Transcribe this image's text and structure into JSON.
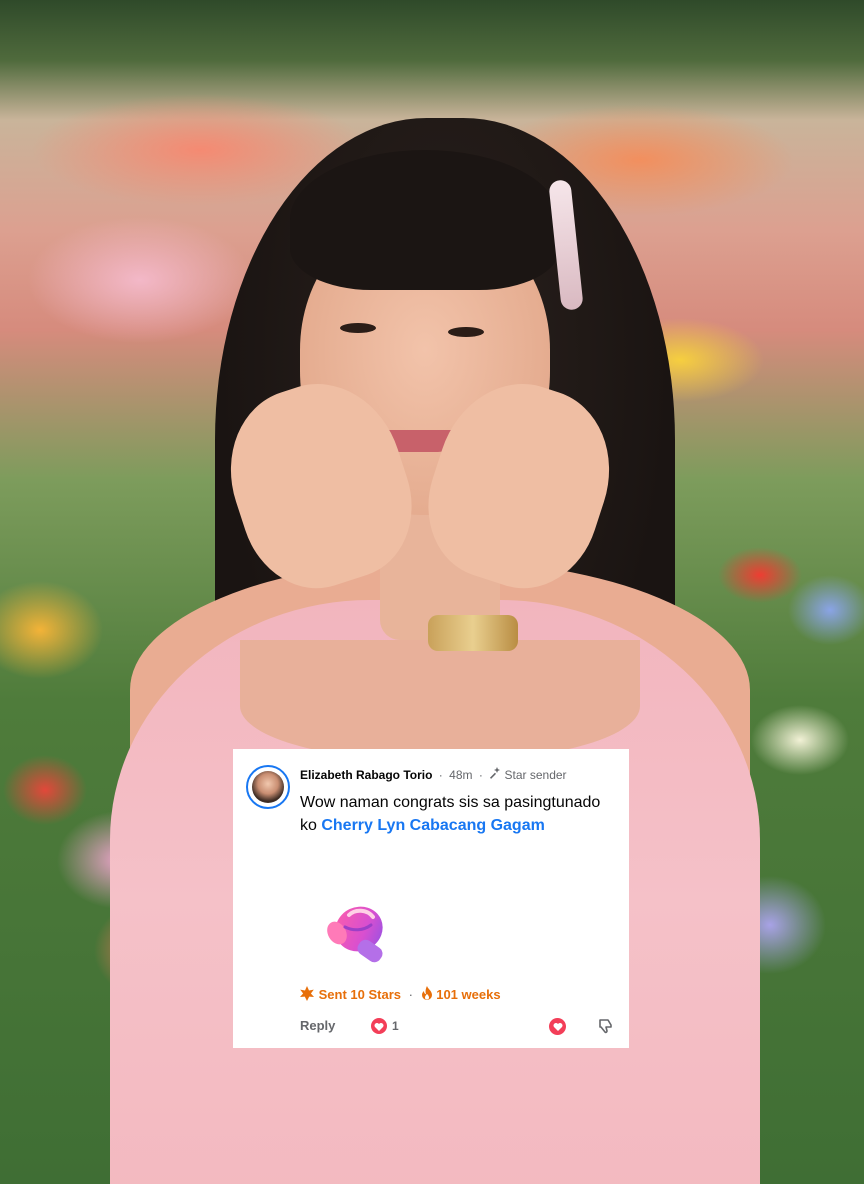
{
  "comment": {
    "author_name": "Elizabeth Rabago Torio",
    "time_ago": "48m",
    "badge": "Star sender",
    "text_prefix": "Wow naman congrats sis sa pasingtunado ko ",
    "mention": "Cherry Lyn Cabacang Gagam",
    "sticker": "boxing-glove-sticker",
    "stars_sent": "Sent 10 Stars",
    "streak": "101 weeks",
    "reply_label": "Reply",
    "reaction_count": "1"
  },
  "colors": {
    "mention": "#1877f2",
    "stars": "#e76f0a",
    "reaction": "#f33e58"
  }
}
